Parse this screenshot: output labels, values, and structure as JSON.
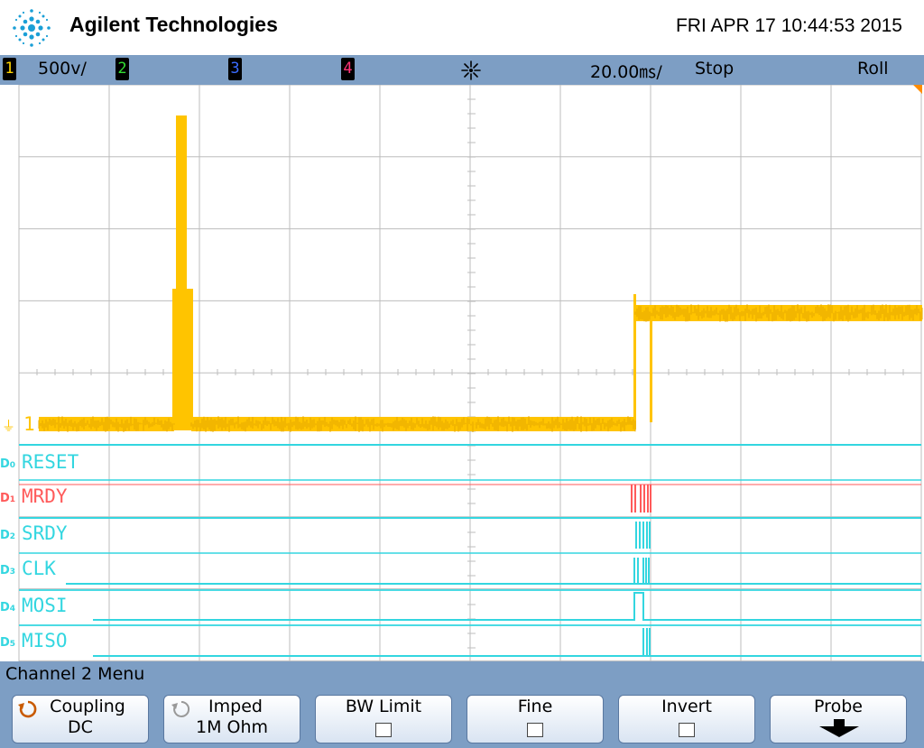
{
  "header": {
    "brand": "Agilent Technologies",
    "datetime": "FRI APR 17 10:44:53 2015"
  },
  "status_bar": {
    "channels": [
      {
        "num": "1",
        "scale": "500ⅴ/",
        "color": "#ffd400"
      },
      {
        "num": "2",
        "color": "#33dd33"
      },
      {
        "num": "3",
        "color": "#3a6cff"
      },
      {
        "num": "4",
        "color": "#ff3377"
      }
    ],
    "timebase": "20.00㎳/",
    "run_state": "Stop",
    "mode": "Roll"
  },
  "analog_marker": {
    "ground_symbol": "⏚",
    "label": "1"
  },
  "digital_channels": [
    {
      "id": "D0",
      "num": "0",
      "name": "RESET",
      "color": "#33d6e0"
    },
    {
      "id": "D1",
      "num": "1",
      "name": "MRDY",
      "color": "#ff5a5a"
    },
    {
      "id": "D2",
      "num": "2",
      "name": "SRDY",
      "color": "#33d6e0"
    },
    {
      "id": "D3",
      "num": "3",
      "name": "CLK",
      "color": "#33d6e0"
    },
    {
      "id": "D4",
      "num": "4",
      "name": "MOSI",
      "color": "#33d6e0"
    },
    {
      "id": "D5",
      "num": "5",
      "name": "MISO",
      "color": "#33d6e0"
    }
  ],
  "menu": {
    "title": "Channel 2  Menu",
    "softkeys": [
      {
        "label": "Coupling",
        "value": "DC",
        "icon": "cycle-arrow-icon"
      },
      {
        "label": "Imped",
        "value": "1M Ohm",
        "icon": "cycle-arrow-icon"
      },
      {
        "label": "BW Limit",
        "icon": "checkbox-icon"
      },
      {
        "label": "Fine",
        "icon": "checkbox-icon"
      },
      {
        "label": "Invert",
        "icon": "checkbox-icon"
      },
      {
        "label": "Probe",
        "icon": "arrow-down-icon"
      }
    ]
  },
  "colors": {
    "trace": "#ffc400",
    "grid": "#bdbdbd",
    "digital": "#33d6e0",
    "digital_alt": "#ff5a5a",
    "bar": "#7d9ec4"
  }
}
